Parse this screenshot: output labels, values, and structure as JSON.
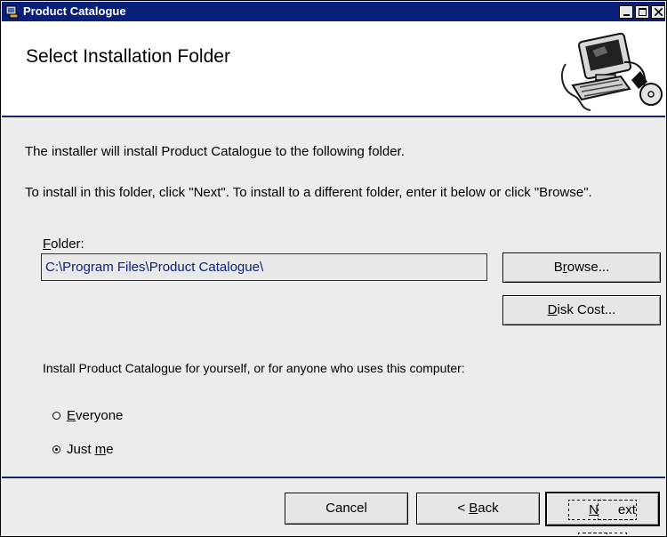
{
  "window": {
    "title": "Product Catalogue",
    "controls": {
      "minimize": "_",
      "maximize": "□",
      "close": "×"
    }
  },
  "banner": {
    "heading": "Select Installation Folder",
    "image_icon": "computer-installer-icon"
  },
  "description": {
    "line1": "The installer will install Product Catalogue to the following folder.",
    "line2": "To install in this folder, click \"Next\". To install to a different folder, enter it below or click \"Browse\"."
  },
  "folder": {
    "label_mnemonic": "F",
    "label_rest": "older:",
    "value": "C:\\Program Files\\Product Catalogue\\"
  },
  "buttons": {
    "browse": {
      "pre": "B",
      "mnemonic": "r",
      "post": "owse..."
    },
    "disk_cost": {
      "pre": "",
      "mnemonic": "D",
      "post": "isk Cost..."
    },
    "cancel": "Cancel",
    "back": {
      "pre": "< ",
      "mnemonic": "B",
      "post": "ack"
    },
    "next": {
      "pre": "",
      "mnemonic": "N",
      "post": "ext >"
    }
  },
  "scope": {
    "label": "Install Product Catalogue for yourself, or for anyone who uses this computer:",
    "options": [
      {
        "pre": "",
        "mnemonic": "E",
        "post": "veryone",
        "selected": false
      },
      {
        "pre": "Just ",
        "mnemonic": "m",
        "post": "e",
        "selected": true
      }
    ]
  },
  "colors": {
    "titlebar": "#0a1f7a",
    "accent_line": "#16246a",
    "folder_text": "#0a1f7a",
    "dialog_bg": "#ececec"
  }
}
